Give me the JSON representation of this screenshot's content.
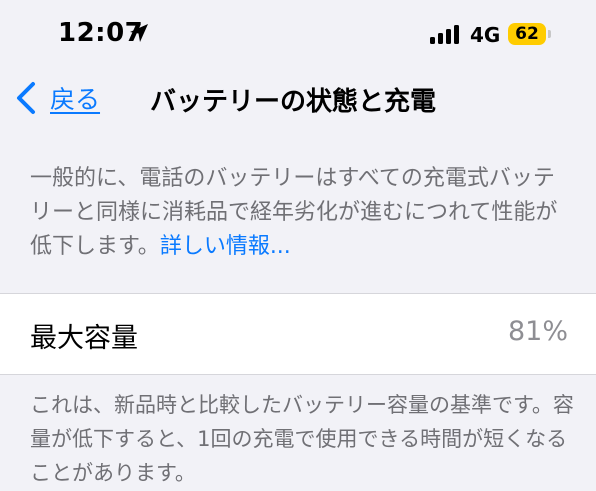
{
  "status_bar": {
    "time": "12:07",
    "network": "4G",
    "battery": "62",
    "battery_color": "#ffcc00",
    "icons": [
      "location-arrow-icon",
      "signal-bars-icon",
      "battery-icon"
    ]
  },
  "navbar": {
    "back_label": "戻る",
    "title": "バッテリーの状態と充電",
    "accent_color": "#0a7aff"
  },
  "description": {
    "text": "一般的に、電話のバッテリーはすべての充電式バッテリーと同様に消耗品で経年劣化が進むにつれて性能が低下します。",
    "link_label": "詳しい情報..."
  },
  "capacity": {
    "label": "最大容量",
    "value": "81%"
  },
  "footer": {
    "text": "これは、新品時と比較したバッテリー容量の基準です。容量が低下すると、1回の充電で使用できる時間が短くなることがあります。"
  }
}
